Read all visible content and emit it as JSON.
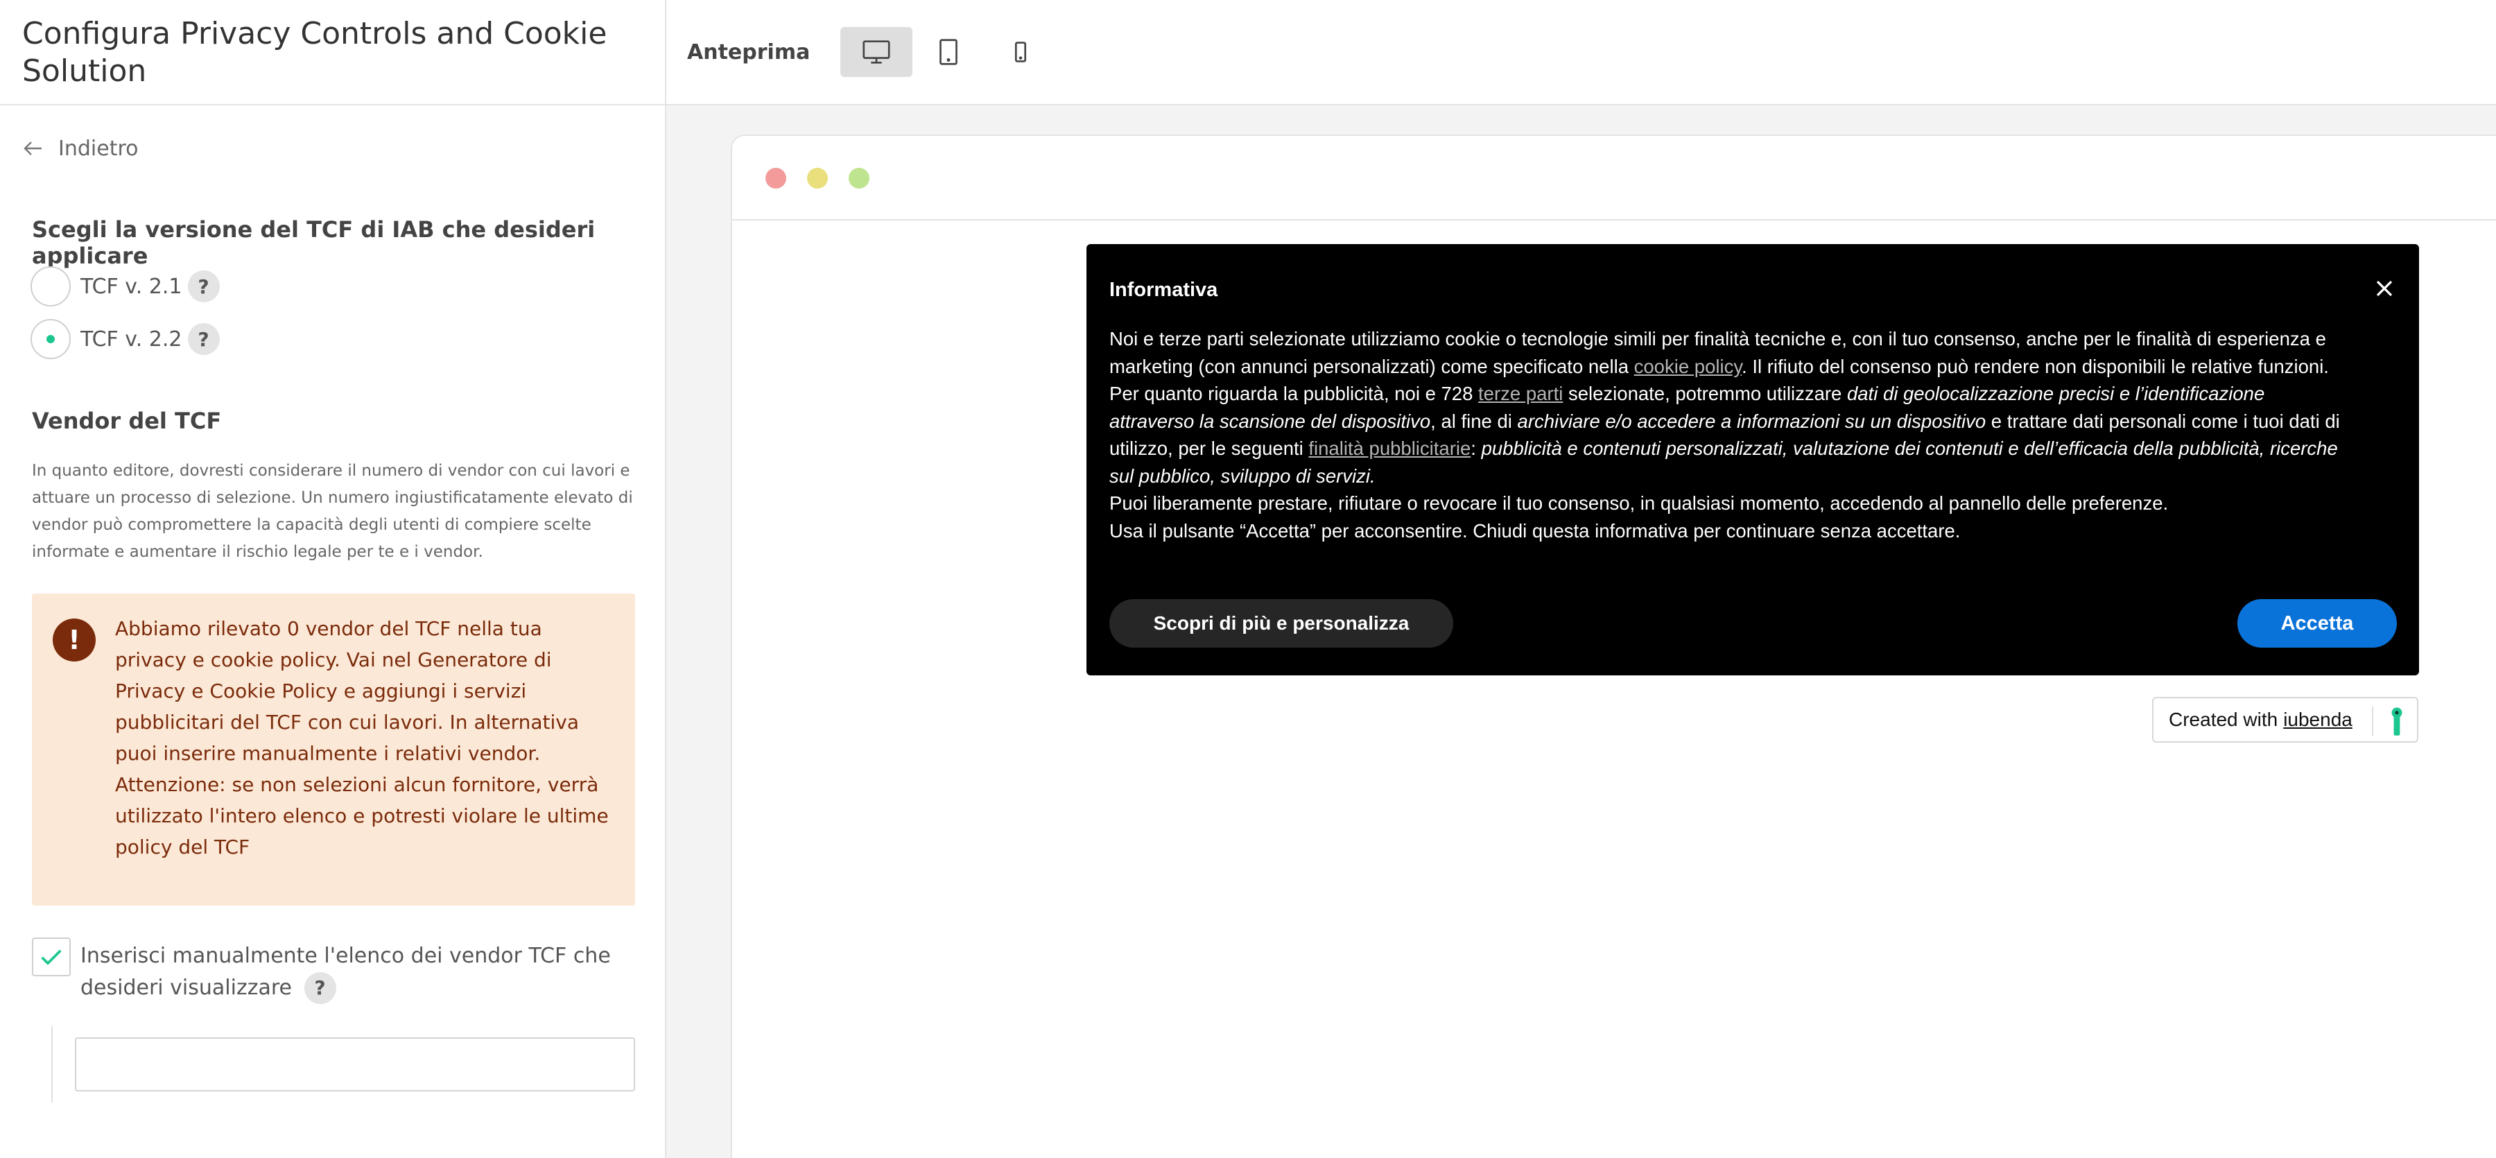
{
  "sidebar": {
    "title": "Configura Privacy Controls and Cookie Solution",
    "back_label": "Indietro",
    "tcf_section": {
      "title": "Scegli la versione del TCF di IAB che desideri applicare",
      "options": [
        {
          "label": "TCF v. 2.1",
          "selected": false
        },
        {
          "label": "TCF v. 2.2",
          "selected": true
        }
      ],
      "help": "?"
    },
    "vendor_section": {
      "title": "Vendor del TCF",
      "description": "In quanto editore, dovresti considerare il numero di vendor con cui lavori e attuare un processo di selezione. Un numero ingiustificatamente elevato di vendor può compromettere la capacità degli utenti di compiere scelte informate e aumentare il rischio legale per te e i vendor."
    },
    "alert": {
      "icon": "!",
      "text_line1": "Abbiamo rilevato 0 vendor del TCF nella tua privacy e cookie policy. Vai nel Generatore di Privacy e Cookie Policy e aggiungi i servizi pubblicitari del TCF con cui lavori. In alternativa puoi inserire manualmente i relativi vendor.",
      "text_line2": "Attenzione: se non selezioni alcun fornitore, verrà utilizzato l'intero elenco e potresti violare le ultime policy del TCF"
    },
    "manual_vendors": {
      "label": "Inserisci manualmente l'elenco dei vendor TCF che desideri visualizzare",
      "checked": true,
      "input_value": ""
    }
  },
  "preview": {
    "label": "Anteprima",
    "devices": [
      "desktop-icon",
      "tablet-icon",
      "mobile-icon"
    ],
    "active_device": "desktop",
    "window_dots": [
      "#f39b9b",
      "#e9df7c",
      "#bfe48f"
    ]
  },
  "banner": {
    "title": "Informativa",
    "p1_a": "Noi e terze parti selezionate utilizziamo cookie o tecnologie simili per finalità tecniche e, con il tuo consenso, anche per le finalità di esperienza e marketing (con annunci personalizzati) come specificato nella ",
    "p1_link": "cookie policy",
    "p1_b": ". Il rifiuto del consenso può rendere non disponibili le relative funzioni.",
    "p2_a": "Per quanto riguarda la pubblicità, noi e 728 ",
    "p2_link1": "terze parti",
    "p2_b": " selezionate, potremmo utilizzare ",
    "p2_i1": "dati di geolocalizzazione precisi e l’identificazione attraverso la scansione del dispositivo",
    "p2_c": ", al fine di ",
    "p2_i2": "archiviare e/o accedere a informazioni su un dispositivo",
    "p2_d": " e trattare dati personali come i tuoi dati di utilizzo, per le seguenti ",
    "p2_link2": "finalità pubblicitarie",
    "p2_e": ": ",
    "p2_i3": "pubblicità e contenuti personalizzati, valutazione dei contenuti e dell’efficacia della pubblicità, ricerche sul pubblico, sviluppo di servizi.",
    "p3": "Puoi liberamente prestare, rifiutare o revocare il tuo consenso, in qualsiasi momento, accedendo al pannello delle preferenze.",
    "p4": "Usa il pulsante “Accetta” per acconsentire. Chiudi questa informativa per continuare senza accettare.",
    "btn_more": "Scopri di più e personalizza",
    "btn_accept": "Accetta",
    "accept_color": "#0a73d9"
  },
  "created_with": {
    "text": "Created with",
    "link": "iubenda",
    "brand_color": "#1cc691"
  }
}
